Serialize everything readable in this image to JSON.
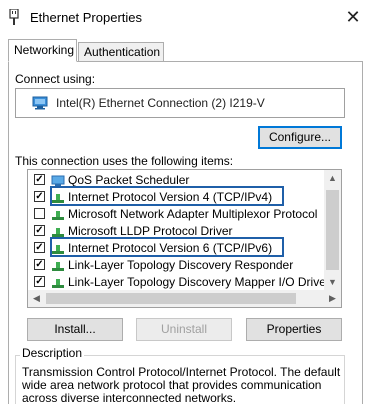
{
  "window": {
    "title": "Ethernet Properties",
    "close_glyph": "✕"
  },
  "tabs": [
    {
      "label": "Networking",
      "active": true
    },
    {
      "label": "Authentication",
      "active": false
    }
  ],
  "connect": {
    "label": "Connect using:",
    "adapter": "Intel(R) Ethernet Connection (2) I219-V",
    "adapter_icon": "network-adapter-icon"
  },
  "buttons": {
    "configure": "Configure...",
    "install": "Install...",
    "uninstall": "Uninstall",
    "properties": "Properties"
  },
  "items_label": "This connection uses the following items:",
  "items": [
    {
      "label": "QoS Packet Scheduler",
      "checked": true,
      "icon": "service-icon"
    },
    {
      "label": "Internet Protocol Version 4 (TCP/IPv4)",
      "checked": true,
      "icon": "protocol-icon",
      "highlighted": true
    },
    {
      "label": "Microsoft Network Adapter Multiplexor Protocol",
      "checked": false,
      "icon": "protocol-icon"
    },
    {
      "label": "Microsoft LLDP Protocol Driver",
      "checked": true,
      "icon": "protocol-icon"
    },
    {
      "label": "Internet Protocol Version 6 (TCP/IPv6)",
      "checked": true,
      "icon": "protocol-icon",
      "highlighted": true
    },
    {
      "label": "Link-Layer Topology Discovery Responder",
      "checked": true,
      "icon": "protocol-icon"
    },
    {
      "label": "Link-Layer Topology Discovery Mapper I/O Driver",
      "checked": true,
      "icon": "protocol-icon"
    }
  ],
  "description": {
    "legend": "Description",
    "text": "Transmission Control Protocol/Internet Protocol. The default wide area network protocol that provides communication across diverse interconnected networks."
  },
  "colors": {
    "highlight": "#1f5fa8",
    "accent": "#0078d7"
  }
}
